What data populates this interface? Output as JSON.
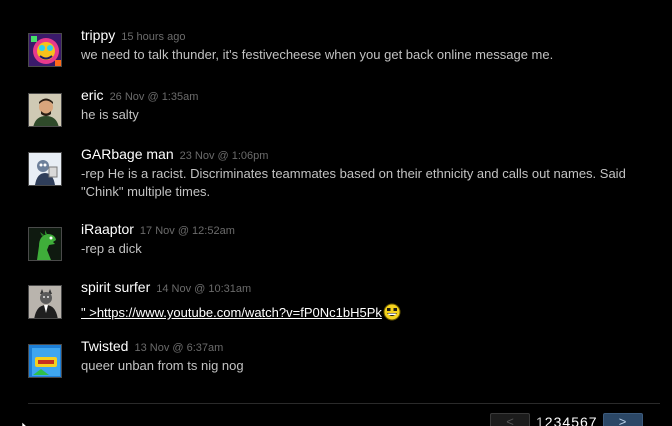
{
  "comments": [
    {
      "author": "trippy",
      "timestamp": "15 hours ago",
      "text": "we need to talk thunder, it's festivecheese when you get back online message me.",
      "avatar_icon": "colorful-abstract-avatar-icon"
    },
    {
      "author": "eric",
      "timestamp": "26 Nov @ 1:35am",
      "text": "he is salty",
      "avatar_icon": "man-portrait-avatar-icon"
    },
    {
      "author": "GARbage man",
      "timestamp": "23 Nov @ 1:06pm",
      "text": "-rep He is a racist. Discriminates teammates based on their ethnicity and calls out names. Said \"Chink\" multiple times.",
      "avatar_icon": "cartoon-avatar-icon"
    },
    {
      "author": "iRaaptor",
      "timestamp": "17 Nov @ 12:52am",
      "text": "-rep a dick",
      "avatar_icon": "green-dinosaur-avatar-icon"
    },
    {
      "author": "spirit surfer",
      "timestamp": "14 Nov @ 10:31am",
      "link_text": "\" >https://www.youtube.com/watch?v=fP0Nc1bH5Pk",
      "emoticon_icon": "yellow-grin-emoticon-icon",
      "avatar_icon": "suited-cat-avatar-icon"
    },
    {
      "author": "Twisted",
      "timestamp": "13 Nov @ 6:37am",
      "text": "queer unban from ts nig nog",
      "avatar_icon": "blue-logo-avatar-icon"
    }
  ],
  "pagination": {
    "prev_label": "<",
    "next_label": ">",
    "pages": [
      "1",
      "2",
      "3",
      "4",
      "5",
      "6",
      "7"
    ],
    "current_page": "1"
  },
  "colors": {
    "background": "#000000",
    "author": "#ffffff",
    "timestamp": "#6b6b6b",
    "comment_text": "#c2c2c2",
    "next_button": "#2b4766"
  }
}
